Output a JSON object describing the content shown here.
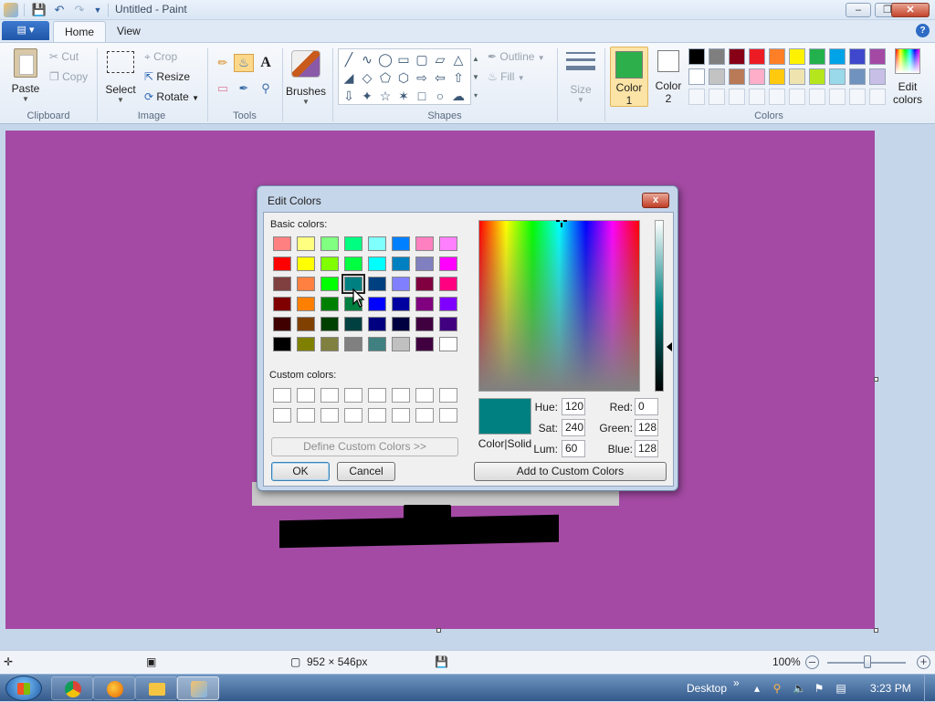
{
  "window": {
    "title": "Untitled - Paint"
  },
  "tabs": {
    "file": "",
    "home": "Home",
    "view": "View"
  },
  "ribbon": {
    "clipboard": {
      "paste": "Paste",
      "cut": "Cut",
      "copy": "Copy",
      "label": "Clipboard"
    },
    "image": {
      "select": "Select",
      "crop": "Crop",
      "resize": "Resize",
      "rotate": "Rotate",
      "label": "Image"
    },
    "tools": {
      "label": "Tools"
    },
    "brushes": {
      "label": "Brushes"
    },
    "shapes": {
      "outline": "Outline",
      "fill": "Fill",
      "label": "Shapes"
    },
    "size": {
      "label": "Size"
    },
    "colors": {
      "color1": "Color",
      "color1_num": "1",
      "color2": "Color",
      "color2_num": "2",
      "edit": "Edit",
      "edit2": "colors",
      "label": "Colors",
      "color1_value": "#2db04b",
      "color2_value": "#ffffff",
      "palette_row1": [
        "#000000",
        "#7f7f7f",
        "#880015",
        "#ed1c24",
        "#ff7f27",
        "#fff200",
        "#22b14c",
        "#00a2e8",
        "#3f48cc",
        "#a349a4"
      ],
      "palette_row2": [
        "#ffffff",
        "#c3c3c3",
        "#b97a57",
        "#ffaec9",
        "#ffc90e",
        "#efe4b0",
        "#b5e61d",
        "#99d9ea",
        "#7092be",
        "#c8bfe7"
      ]
    }
  },
  "canvas": {
    "background": "#a44aa4"
  },
  "statusbar": {
    "size": "952 × 546px",
    "zoom": "100%"
  },
  "taskbar": {
    "desktop": "Desktop",
    "chevrons": "»",
    "time": "3:23 PM"
  },
  "dialog": {
    "title": "Edit Colors",
    "close": "x",
    "basic_label": "Basic colors:",
    "custom_label": "Custom colors:",
    "define_btn": "Define Custom Colors >>",
    "ok": "OK",
    "cancel": "Cancel",
    "add_btn": "Add to Custom Colors",
    "preview_label": "Color|Solid",
    "hue_label": "Hue:",
    "hue": "120",
    "sat_label": "Sat:",
    "sat": "240",
    "lum_label": "Lum:",
    "lum": "60",
    "red_label": "Red:",
    "red": "0",
    "green_label": "Green:",
    "green": "128",
    "blue_label": "Blue:",
    "blue": "128",
    "basic_colors": [
      [
        "#ff8080",
        "#ffff80",
        "#80ff80",
        "#00ff80",
        "#80ffff",
        "#0080ff",
        "#ff80c0",
        "#ff80ff"
      ],
      [
        "#ff0000",
        "#ffff00",
        "#80ff00",
        "#00ff40",
        "#00ffff",
        "#0080c0",
        "#8080c0",
        "#ff00ff"
      ],
      [
        "#804040",
        "#ff8040",
        "#00ff00",
        "#008080",
        "#004080",
        "#8080ff",
        "#800040",
        "#ff0080"
      ],
      [
        "#800000",
        "#ff8000",
        "#008000",
        "#008040",
        "#0000ff",
        "#0000a0",
        "#800080",
        "#8000ff"
      ],
      [
        "#400000",
        "#804000",
        "#004000",
        "#004040",
        "#000080",
        "#000040",
        "#400040",
        "#400080"
      ],
      [
        "#000000",
        "#808000",
        "#808040",
        "#808080",
        "#408080",
        "#c0c0c0",
        "#400040",
        "#ffffff"
      ]
    ],
    "selected_color": "#008080"
  }
}
